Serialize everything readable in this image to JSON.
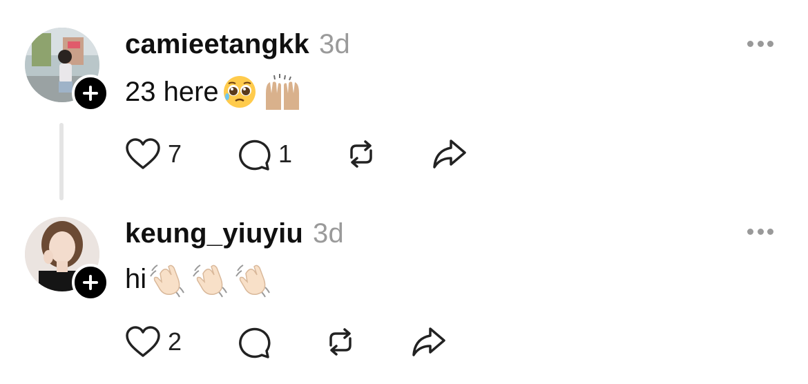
{
  "posts": [
    {
      "username": "camieetangkk",
      "time": "3d",
      "text": "23 here",
      "emojis": [
        "pleading-face",
        "raising-hands"
      ],
      "likes": "7",
      "replies": "1",
      "has_thread_line": true
    },
    {
      "username": "keung_yiuyiu",
      "time": "3d",
      "text": "hi",
      "emojis": [
        "waving-hand",
        "waving-hand",
        "waving-hand"
      ],
      "likes": "2",
      "replies": "",
      "has_thread_line": false
    }
  ]
}
